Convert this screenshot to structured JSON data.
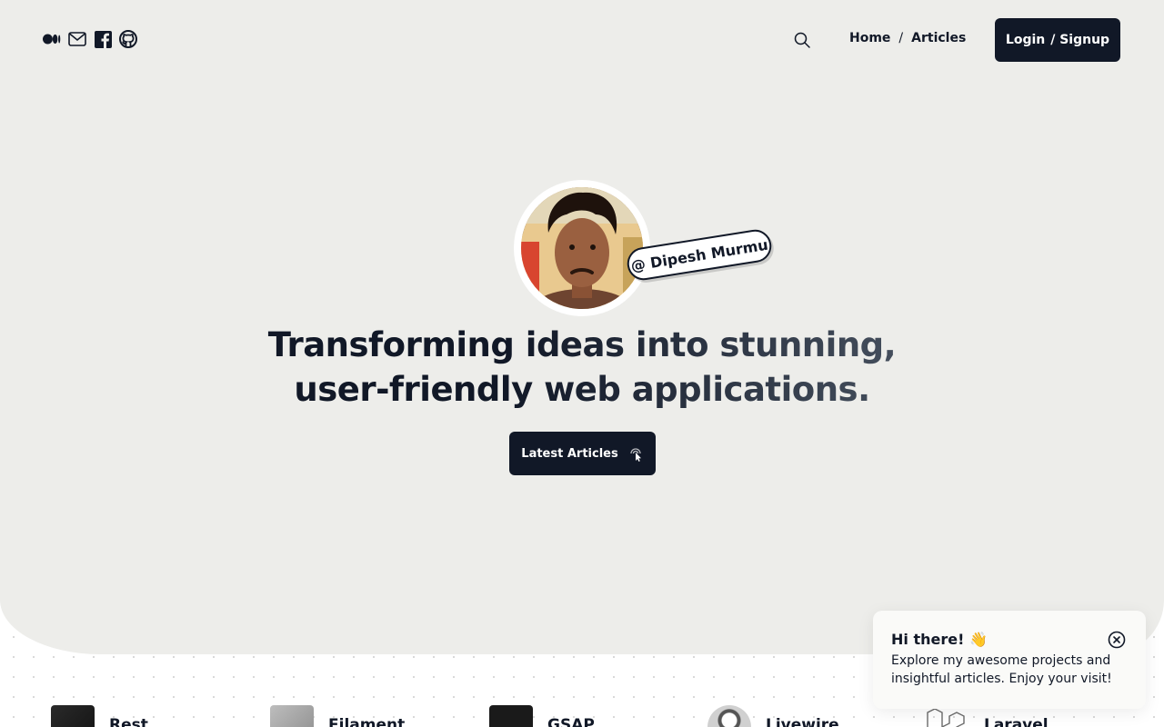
{
  "header": {
    "social_icons": [
      "medium-icon",
      "mail-icon",
      "facebook-icon",
      "github-icon"
    ],
    "nav": {
      "home": "Home",
      "separator": "/",
      "articles": "Articles"
    },
    "login": {
      "login": "Login",
      "signup": "/ Signup"
    }
  },
  "hero": {
    "name_tag": "@ Dipesh Murmu",
    "headline_line1": "Transforming ideas into stunning,",
    "headline_line2": "user-friendly web applications.",
    "cta": "Latest Articles"
  },
  "tech": [
    {
      "label": "Rest"
    },
    {
      "label": "Filament"
    },
    {
      "label": "GSAP"
    },
    {
      "label": "Livewire"
    },
    {
      "label": "Laravel"
    }
  ],
  "toast": {
    "title": "Hi there! 👋",
    "body": "Explore my awesome projects and insightful articles. Enjoy your visit!"
  },
  "colors": {
    "dark": "#111827",
    "hero_bg": "#ededea"
  }
}
